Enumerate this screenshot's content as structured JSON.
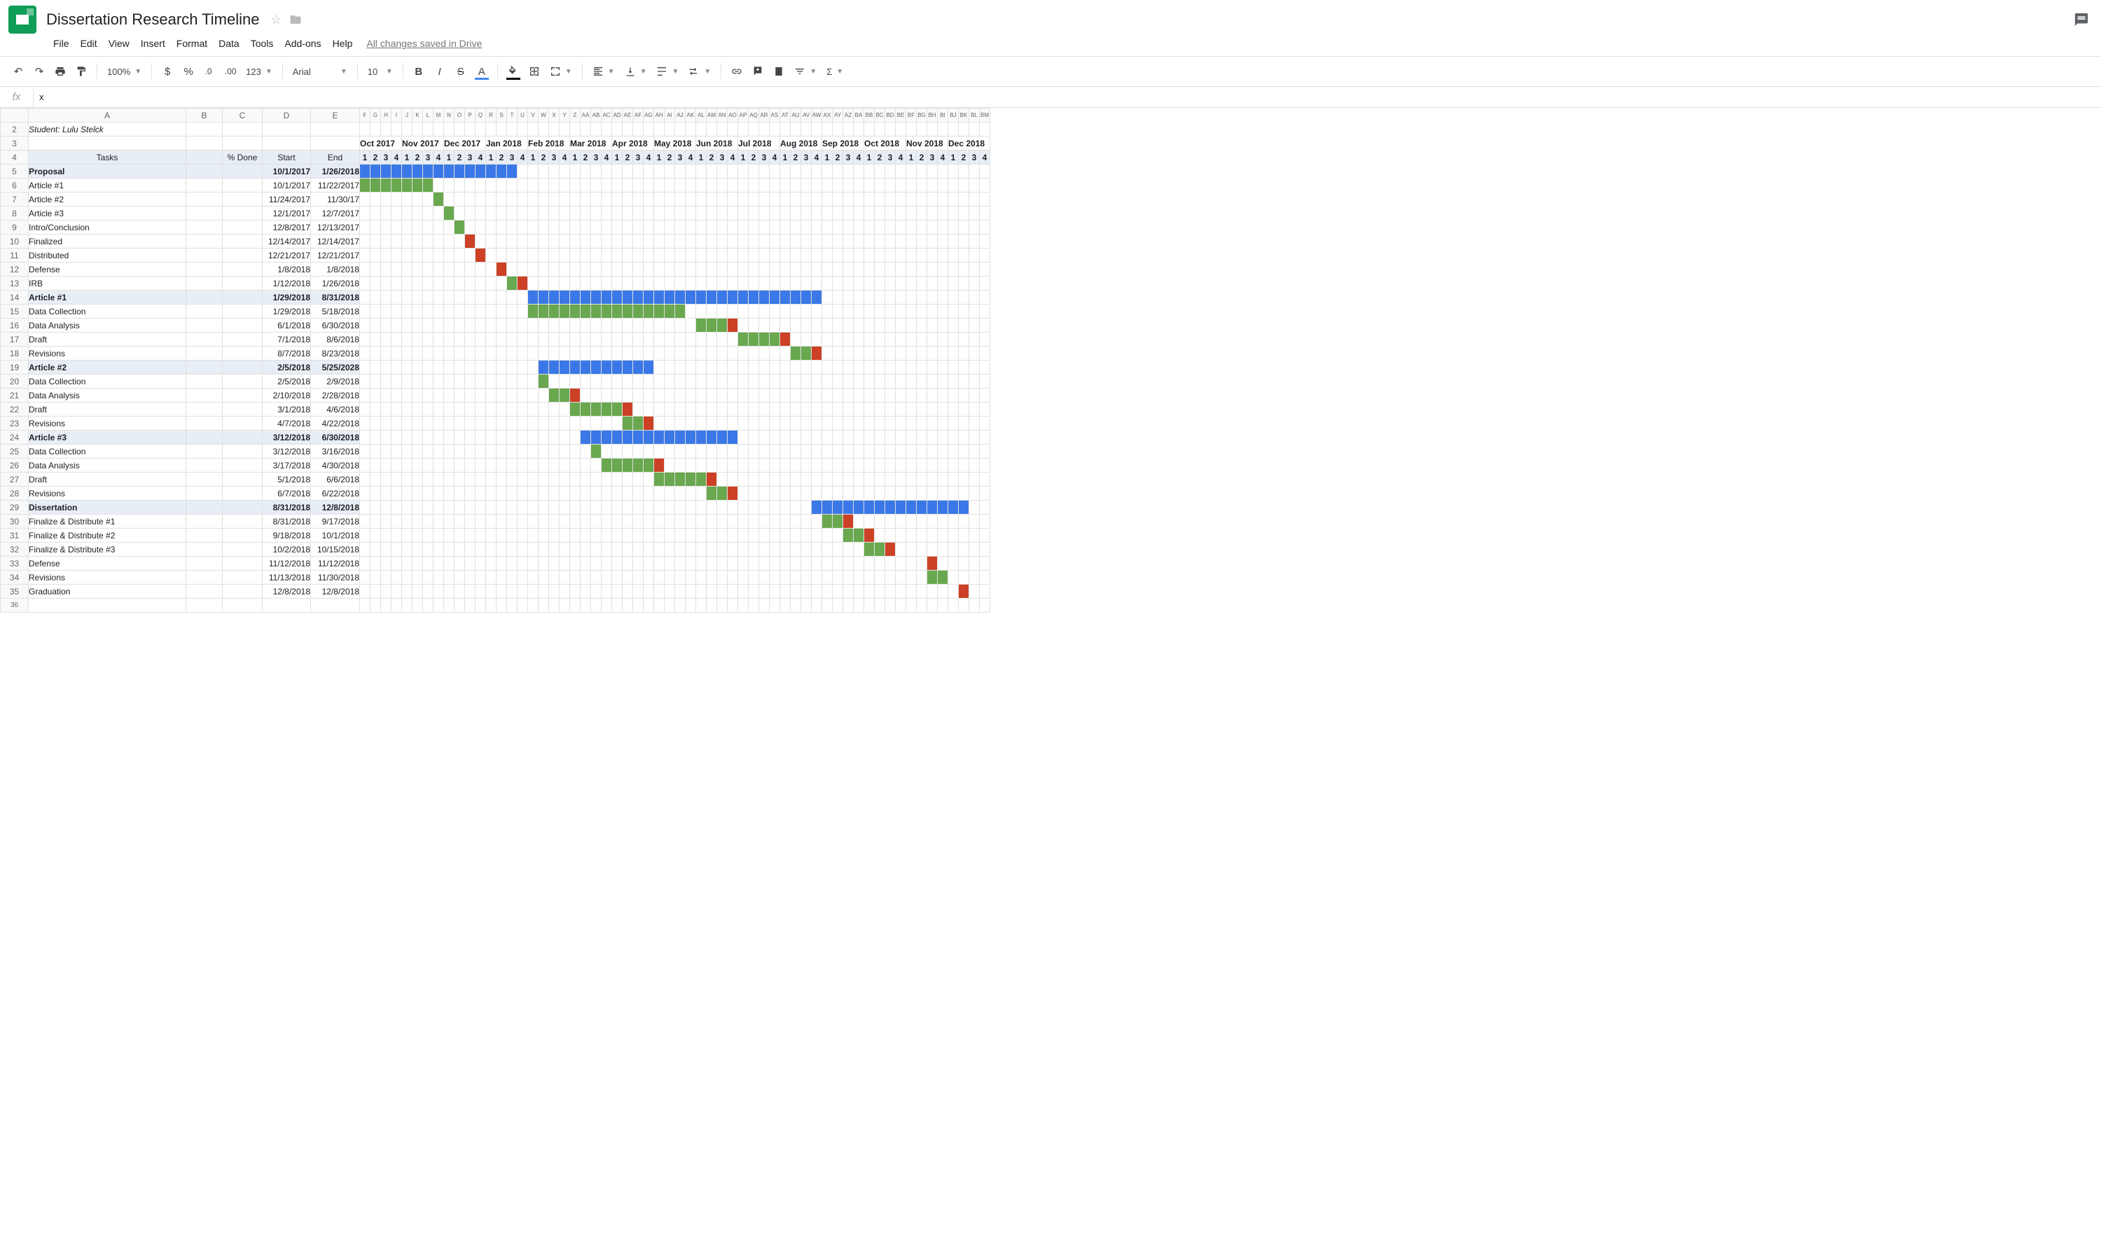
{
  "doc": {
    "title": "Dissertation Research Timeline",
    "saved": "All changes saved in Drive"
  },
  "menu": [
    "File",
    "Edit",
    "View",
    "Insert",
    "Format",
    "Data",
    "Tools",
    "Add-ons",
    "Help"
  ],
  "toolbar": {
    "zoom": "100%",
    "font": "Arial",
    "size": "10",
    "numfmt": "123"
  },
  "fx": {
    "value": "x"
  },
  "colLetters": [
    "A",
    "B",
    "C",
    "D",
    "E",
    "F",
    "G",
    "H",
    "I",
    "J",
    "K",
    "L",
    "M",
    "N",
    "O",
    "P",
    "Q",
    "R",
    "S",
    "T",
    "U",
    "V",
    "W",
    "X",
    "Y",
    "Z",
    "AA",
    "AB",
    "AC",
    "AD",
    "AE",
    "AF",
    "AG",
    "AH",
    "AI",
    "AJ",
    "AK",
    "AL",
    "AM",
    "AN",
    "AO",
    "AP",
    "AQ",
    "AR",
    "AS",
    "AT",
    "AU",
    "AV",
    "AW",
    "AX",
    "AY",
    "AZ",
    "BA",
    "BB",
    "BC",
    "BD",
    "BE",
    "BF",
    "BG",
    "BH",
    "BI",
    "BJ",
    "BK",
    "BL",
    "BM"
  ],
  "selectedColIdx": 9,
  "months": [
    "Oct 2017",
    "Nov 2017",
    "Dec 2017",
    "Jan 2018",
    "Feb 2018",
    "Mar 2018",
    "Apr 2018",
    "May 2018",
    "Jun 2018",
    "Jul 2018",
    "Aug 2018",
    "Sep 2018",
    "Oct 2018",
    "Nov 2018",
    "Dec 2018"
  ],
  "weeksPerMonth": 4,
  "student": "Student: Lulu Stelck",
  "headers": {
    "tasks": "Tasks",
    "pct": "% Done",
    "start": "Start",
    "end": "End"
  },
  "rows": [
    {
      "n": 5,
      "task": "Proposal",
      "bold": true,
      "hdr": true,
      "start": "10/1/2017",
      "end": "1/26/2018",
      "gantt": [
        {
          "c": "blue",
          "s": 0,
          "e": 15
        }
      ]
    },
    {
      "n": 6,
      "task": "Article #1",
      "start": "10/1/2017",
      "end": "11/22/2017",
      "gantt": [
        {
          "c": "green",
          "s": 0,
          "e": 7
        }
      ]
    },
    {
      "n": 7,
      "task": "Article #2",
      "start": "11/24/2017",
      "end": "11/30/17",
      "gantt": [
        {
          "c": "green",
          "s": 7,
          "e": 8
        }
      ]
    },
    {
      "n": 8,
      "task": "Article #3",
      "start": "12/1/2017",
      "end": "12/7/2017",
      "gantt": [
        {
          "c": "green",
          "s": 8,
          "e": 9
        }
      ]
    },
    {
      "n": 9,
      "task": "Intro/Conclusion",
      "start": "12/8/2017",
      "end": "12/13/2017",
      "gantt": [
        {
          "c": "green",
          "s": 9,
          "e": 10
        }
      ]
    },
    {
      "n": 10,
      "task": "Finalized",
      "start": "12/14/2017",
      "end": "12/14/2017",
      "gantt": [
        {
          "c": "red",
          "s": 10,
          "e": 11
        }
      ]
    },
    {
      "n": 11,
      "task": "Distributed",
      "start": "12/21/2017",
      "end": "12/21/2017",
      "gantt": [
        {
          "c": "red",
          "s": 11,
          "e": 12
        }
      ]
    },
    {
      "n": 12,
      "task": "Defense",
      "start": "1/8/2018",
      "end": "1/8/2018",
      "gantt": [
        {
          "c": "red",
          "s": 13,
          "e": 14
        }
      ]
    },
    {
      "n": 13,
      "task": "IRB",
      "start": "1/12/2018",
      "end": "1/26/2018",
      "gantt": [
        {
          "c": "green",
          "s": 14,
          "e": 15
        },
        {
          "c": "red",
          "s": 15,
          "e": 16
        }
      ]
    },
    {
      "n": 14,
      "task": "Article #1",
      "bold": true,
      "hdr": true,
      "start": "1/29/2018",
      "end": "8/31/2018",
      "gantt": [
        {
          "c": "blue",
          "s": 16,
          "e": 44
        }
      ]
    },
    {
      "n": 15,
      "task": "Data Collection",
      "start": "1/29/2018",
      "end": "5/18/2018",
      "gantt": [
        {
          "c": "green",
          "s": 16,
          "e": 31
        }
      ]
    },
    {
      "n": 16,
      "task": "Data Analysis",
      "start": "6/1/2018",
      "end": "6/30/2018",
      "gantt": [
        {
          "c": "green",
          "s": 32,
          "e": 35
        },
        {
          "c": "red",
          "s": 35,
          "e": 36
        }
      ]
    },
    {
      "n": 17,
      "task": "Draft",
      "start": "7/1/2018",
      "end": "8/6/2018",
      "gantt": [
        {
          "c": "green",
          "s": 36,
          "e": 40
        },
        {
          "c": "red",
          "s": 40,
          "e": 41
        }
      ]
    },
    {
      "n": 18,
      "task": "Revisions",
      "start": "8/7/2018",
      "end": "8/23/2018",
      "gantt": [
        {
          "c": "green",
          "s": 41,
          "e": 43
        },
        {
          "c": "red",
          "s": 43,
          "e": 44
        }
      ]
    },
    {
      "n": 19,
      "task": "Article #2",
      "bold": true,
      "hdr": true,
      "start": "2/5/2018",
      "end": "5/25/2028",
      "gantt": [
        {
          "c": "blue",
          "s": 17,
          "e": 28
        }
      ]
    },
    {
      "n": 20,
      "task": "Data Collection",
      "start": "2/5/2018",
      "end": "2/9/2018",
      "gantt": [
        {
          "c": "green",
          "s": 17,
          "e": 18
        }
      ]
    },
    {
      "n": 21,
      "task": "Data Analysis",
      "start": "2/10/2018",
      "end": "2/28/2018",
      "gantt": [
        {
          "c": "green",
          "s": 18,
          "e": 20
        },
        {
          "c": "red",
          "s": 20,
          "e": 21
        }
      ]
    },
    {
      "n": 22,
      "task": "Draft",
      "start": "3/1/2018",
      "end": "4/6/2018",
      "gantt": [
        {
          "c": "green",
          "s": 20,
          "e": 25
        },
        {
          "c": "red",
          "s": 25,
          "e": 26
        }
      ]
    },
    {
      "n": 23,
      "task": "Revisions",
      "start": "4/7/2018",
      "end": "4/22/2018",
      "gantt": [
        {
          "c": "green",
          "s": 25,
          "e": 27
        },
        {
          "c": "red",
          "s": 27,
          "e": 28
        }
      ]
    },
    {
      "n": 24,
      "task": "Article #3",
      "bold": true,
      "hdr": true,
      "start": "3/12/2018",
      "end": "6/30/2018",
      "gantt": [
        {
          "c": "blue",
          "s": 21,
          "e": 36
        }
      ]
    },
    {
      "n": 25,
      "task": "Data Collection",
      "start": "3/12/2018",
      "end": "3/16/2018",
      "gantt": [
        {
          "c": "green",
          "s": 22,
          "e": 23
        }
      ]
    },
    {
      "n": 26,
      "task": "Data Analysis",
      "start": "3/17/2018",
      "end": "4/30/2018",
      "gantt": [
        {
          "c": "green",
          "s": 23,
          "e": 28
        },
        {
          "c": "red",
          "s": 28,
          "e": 29
        }
      ]
    },
    {
      "n": 27,
      "task": "Draft",
      "start": "5/1/2018",
      "end": "6/6/2018",
      "gantt": [
        {
          "c": "green",
          "s": 28,
          "e": 33
        },
        {
          "c": "red",
          "s": 33,
          "e": 34
        }
      ]
    },
    {
      "n": 28,
      "task": "Revisions",
      "start": "6/7/2018",
      "end": "6/22/2018",
      "gantt": [
        {
          "c": "green",
          "s": 33,
          "e": 35
        },
        {
          "c": "red",
          "s": 35,
          "e": 36
        }
      ]
    },
    {
      "n": 29,
      "task": "Dissertation",
      "bold": true,
      "hdr": true,
      "start": "8/31/2018",
      "end": "12/8/2018",
      "gantt": [
        {
          "c": "blue",
          "s": 43,
          "e": 58
        }
      ]
    },
    {
      "n": 30,
      "task": "Finalize & Distribute #1",
      "start": "8/31/2018",
      "end": "9/17/2018",
      "gantt": [
        {
          "c": "green",
          "s": 44,
          "e": 46
        },
        {
          "c": "red",
          "s": 46,
          "e": 47
        }
      ]
    },
    {
      "n": 31,
      "task": "Finalize & Distribute #2",
      "start": "9/18/2018",
      "end": "10/1/2018",
      "gantt": [
        {
          "c": "green",
          "s": 46,
          "e": 48
        },
        {
          "c": "red",
          "s": 48,
          "e": 49
        }
      ]
    },
    {
      "n": 32,
      "task": "Finalize & Distribute #3",
      "start": "10/2/2018",
      "end": "10/15/2018",
      "gantt": [
        {
          "c": "green",
          "s": 48,
          "e": 50
        },
        {
          "c": "red",
          "s": 50,
          "e": 51
        }
      ]
    },
    {
      "n": 33,
      "task": "Defense",
      "start": "11/12/2018",
      "end": "11/12/2018",
      "gantt": [
        {
          "c": "red",
          "s": 54,
          "e": 55
        }
      ]
    },
    {
      "n": 34,
      "task": "Revisions",
      "start": "11/13/2018",
      "end": "11/30/2018",
      "gantt": [
        {
          "c": "green",
          "s": 54,
          "e": 56
        }
      ]
    },
    {
      "n": 35,
      "task": "Graduation",
      "start": "12/8/2018",
      "end": "12/8/2018",
      "gantt": [
        {
          "c": "red",
          "s": 57,
          "e": 58
        }
      ]
    }
  ],
  "extraRow": 36
}
